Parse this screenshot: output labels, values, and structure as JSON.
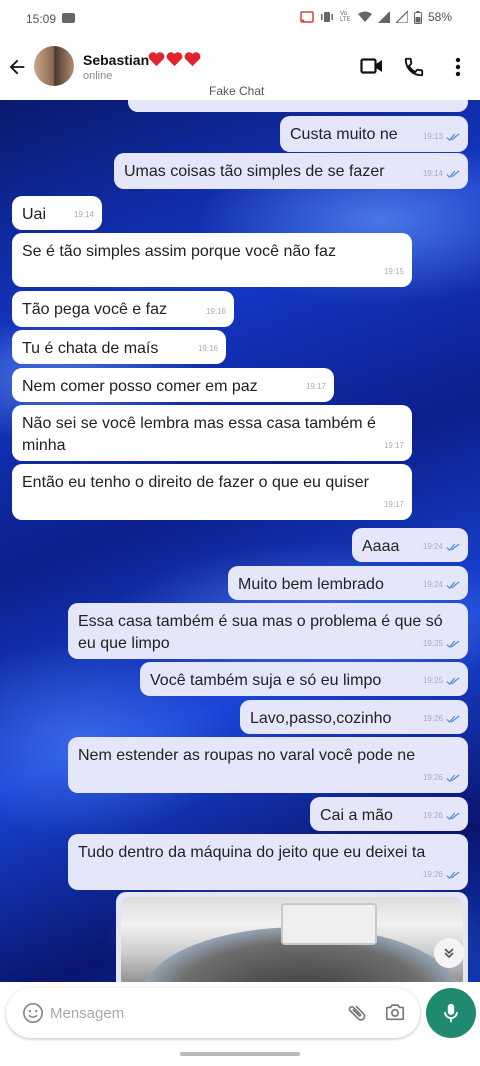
{
  "status_bar": {
    "time": "15:09",
    "battery": "58%",
    "network_label": "Vo LTE"
  },
  "header": {
    "contact_name": "Sebastian",
    "hearts": "❤️❤️❤️",
    "status": "online",
    "watermark": "Fake Chat"
  },
  "messages": [
    {
      "side": "out",
      "text": "Custa muito ne",
      "time": "19:13"
    },
    {
      "side": "out",
      "text": "Umas coisas tão simples de se fazer",
      "time": "19:14"
    },
    {
      "side": "in",
      "text": "Uai",
      "time": "19:14"
    },
    {
      "side": "in",
      "text": "Se é tão simples assim porque você não faz",
      "time": "19:15"
    },
    {
      "side": "in",
      "text": "Tão pega você e faz",
      "time": "19:16"
    },
    {
      "side": "in",
      "text": "Tu é chata de maís",
      "time": "19:16"
    },
    {
      "side": "in",
      "text": "Nem comer posso comer em paz",
      "time": "19:17"
    },
    {
      "side": "in",
      "text": "Não sei se você lembra mas essa casa também é minha",
      "time": "19:17"
    },
    {
      "side": "in",
      "text": "Então eu tenho o direito de fazer o que eu quiser",
      "time": "19:17"
    },
    {
      "side": "out",
      "text": "Aaaa",
      "time": "19:24"
    },
    {
      "side": "out",
      "text": "Muito bem lembrado",
      "time": "19:24"
    },
    {
      "side": "out",
      "text": "Essa casa também é sua mas o problema é que só eu que limpo",
      "time": "19:25"
    },
    {
      "side": "out",
      "text": "Você também suja e só eu limpo",
      "time": "19:25"
    },
    {
      "side": "out",
      "text": "Lavo,passo,cozinho",
      "time": "19:26"
    },
    {
      "side": "out",
      "text": "Nem estender as roupas no varal você pode ne",
      "time": "19:26"
    },
    {
      "side": "out",
      "text": "Cai a mão",
      "time": "19:26"
    },
    {
      "side": "out",
      "text": "Tudo dentro da máquina do jeito que eu deixei ta",
      "time": "19:26"
    }
  ],
  "composer": {
    "placeholder": "Mensagem"
  },
  "colors": {
    "outgoing_bubble": "#e6e6fb",
    "incoming_bubble": "#ffffff",
    "mic_button": "#1f8a70",
    "tick_blue": "#4a8fe0"
  },
  "icons": [
    "back-arrow-icon",
    "video-call-icon",
    "phone-icon",
    "more-vert-icon",
    "emoji-icon",
    "attach-icon",
    "camera-icon",
    "mic-icon",
    "chevron-double-down-icon"
  ]
}
